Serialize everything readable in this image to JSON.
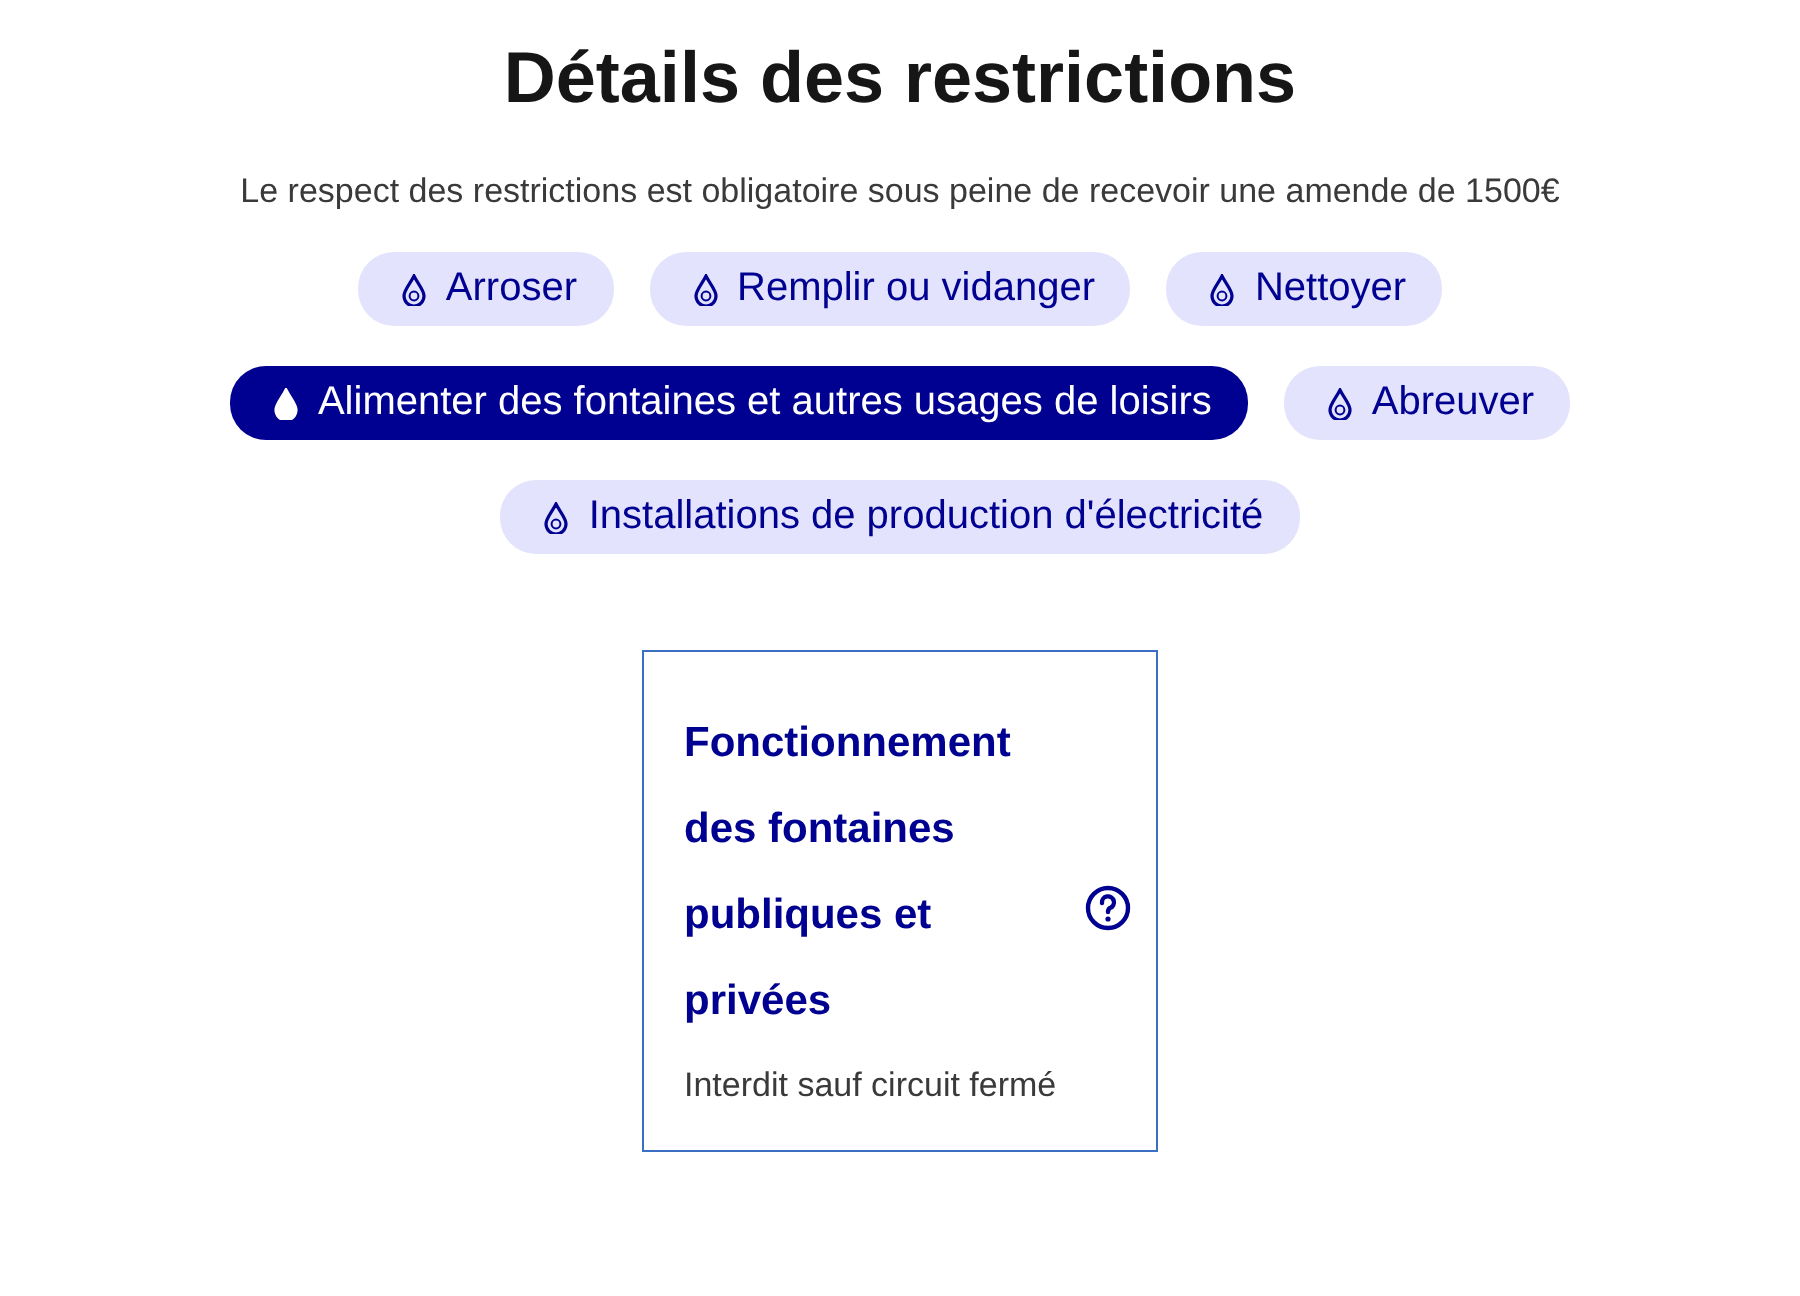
{
  "title": "Détails des restrictions",
  "subtitle": "Le respect des restrictions est obligatoire sous peine de recevoir une amende de 1500€",
  "tag_rows": [
    [
      {
        "label": "Arroser",
        "selected": false
      },
      {
        "label": "Remplir ou vidanger",
        "selected": false
      },
      {
        "label": "Nettoyer",
        "selected": false
      }
    ],
    [
      {
        "label": "Alimenter des fontaines et autres usages de loisirs",
        "selected": true
      },
      {
        "label": "Abreuver",
        "selected": false
      }
    ],
    [
      {
        "label": "Installations de production d'électricité",
        "selected": false
      }
    ]
  ],
  "card": {
    "title": "Fonctionnement des fontaines publiques et privées",
    "description": "Interdit sauf circuit fermé"
  }
}
